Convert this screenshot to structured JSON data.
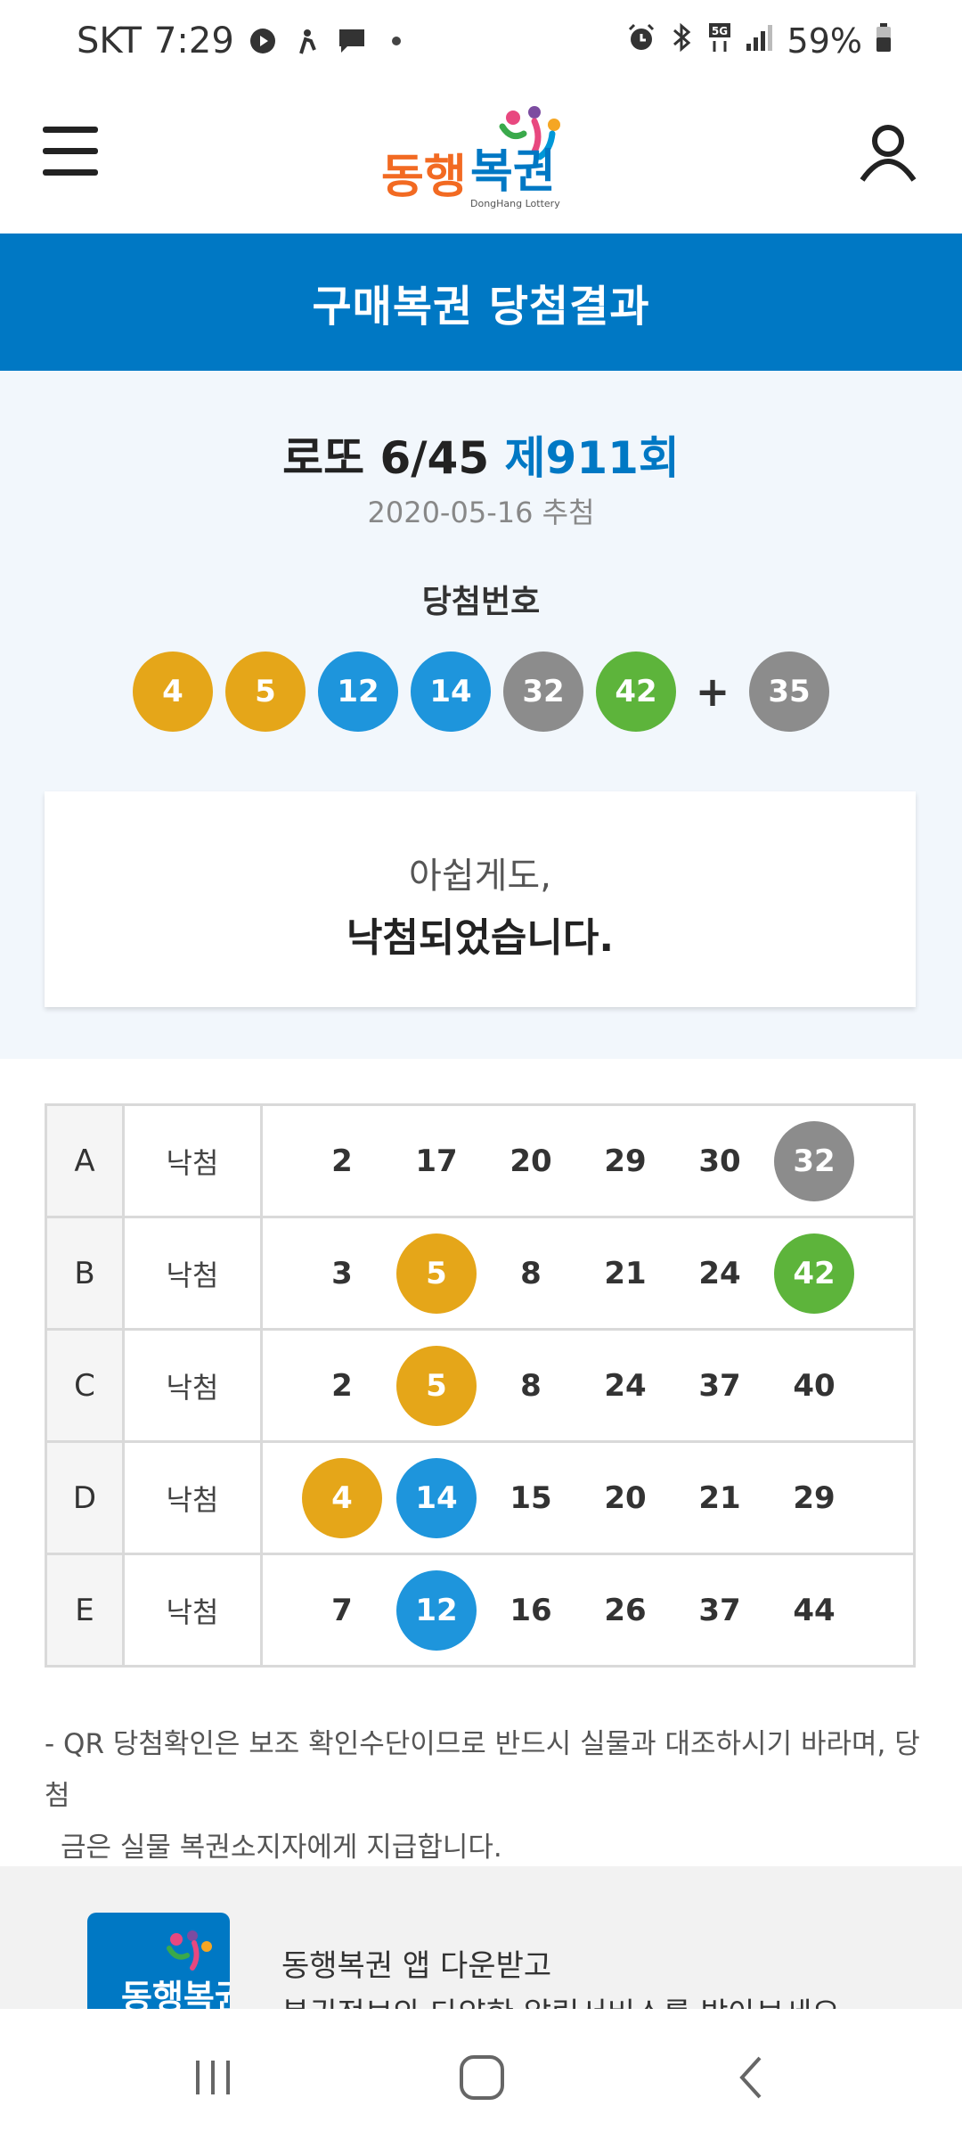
{
  "status_bar": {
    "carrier": "SKT",
    "time": "7:29",
    "battery": "59%"
  },
  "header": {
    "logo_text": "동행복권",
    "logo_subtext": "DongHang Lottery"
  },
  "banner": {
    "title": "구매복권 당첨결과"
  },
  "result": {
    "game": "로또 6/45",
    "round": "제911회",
    "draw_date": "2020-05-16 추첨",
    "winning_label": "당첨번호",
    "winning_numbers": [
      "4",
      "5",
      "12",
      "14",
      "32",
      "42"
    ],
    "plus": "+",
    "bonus_number": "35",
    "message_line1": "아쉽게도,",
    "message_line2": "낙첨되었습니다."
  },
  "tickets": [
    {
      "letter": "A",
      "state": "낙첨",
      "numbers": [
        "2",
        "17",
        "20",
        "29",
        "30",
        "32"
      ]
    },
    {
      "letter": "B",
      "state": "낙첨",
      "numbers": [
        "3",
        "5",
        "8",
        "21",
        "24",
        "42"
      ]
    },
    {
      "letter": "C",
      "state": "낙첨",
      "numbers": [
        "2",
        "5",
        "8",
        "24",
        "37",
        "40"
      ]
    },
    {
      "letter": "D",
      "state": "낙첨",
      "numbers": [
        "4",
        "14",
        "15",
        "20",
        "21",
        "29"
      ]
    },
    {
      "letter": "E",
      "state": "낙첨",
      "numbers": [
        "7",
        "12",
        "16",
        "26",
        "37",
        "44"
      ]
    }
  ],
  "notice": {
    "line1": "- QR 당첨확인은 보조 확인수단이므로 반드시 실물과 대조하시기 바라며, 당첨",
    "line2": "금은 실물 복권소지자에게 지급합니다."
  },
  "promo": {
    "logo_text": "동행복권",
    "line1": "동행복권 앱 다운받고",
    "line2": "복권정보와 다양한 알림서비스를 받아보세요"
  },
  "colors": {
    "primary": "#0078c4",
    "ball_yellow": "#e5a619",
    "ball_blue": "#1e95dc",
    "ball_gray": "#8c8c8c",
    "ball_green": "#5db43b"
  }
}
